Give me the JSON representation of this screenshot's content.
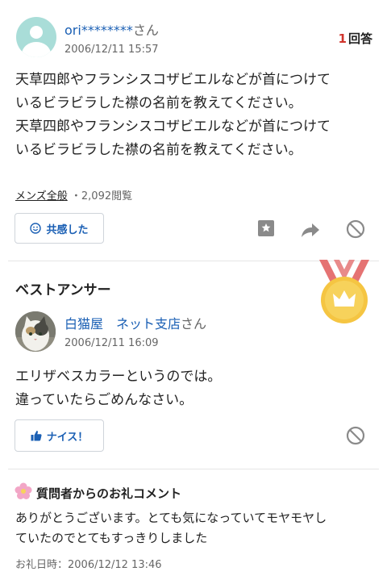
{
  "question": {
    "user_name": "ori********",
    "user_suffix": "さん",
    "timestamp": "2006/12/11 15:57",
    "answer_count_num": "1",
    "answer_count_label": "回答",
    "body_lines": [
      "天草四郎やフランシスコザビエルなどが首につけて",
      "いるビラビラした襟の名前を教えてください。",
      "天草四郎やフランシスコザビエルなどが首につけて",
      "いるビラビラした襟の名前を教えてください。"
    ],
    "category": "メンズ全般",
    "views": "・2,092閲覧",
    "empathy_label": "共感した"
  },
  "best_answer": {
    "title": "ベストアンサー",
    "user_name": "白猫屋　ネット支店",
    "user_suffix": "さん",
    "timestamp": "2006/12/11 16:09",
    "body_lines": [
      "エリザベスカラーというのでは。",
      "違っていたらごめんなさい。"
    ],
    "nice_label": "ナイス！"
  },
  "thanks": {
    "title": "質問者からのお礼コメント",
    "body_lines": [
      "ありがとうございます。とても気になっていてモヤモヤし",
      "ていたのでとてもすっきりしました"
    ],
    "date": "お礼日時：2006/12/12 13:46"
  },
  "icons": {
    "bookmark": "bookmark-icon",
    "share": "share-arrow-icon",
    "block": "block-icon",
    "smile": "smile-icon",
    "thumbs_up": "thumbs-up-icon",
    "medal": "gold-medal-crown-icon",
    "flower": "flower-icon"
  },
  "colors": {
    "link": "#1a5fb4",
    "answer_count": "#d0342c",
    "medal_ribbon": "#e57373",
    "medal_gold": "#f5c542"
  }
}
